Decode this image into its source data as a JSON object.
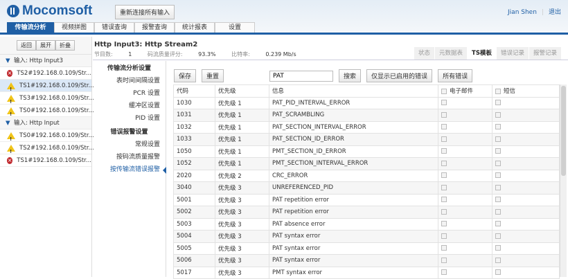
{
  "header": {
    "logo": "Mocomsoft",
    "reconnect": "重新连接所有输入",
    "user": "Jian Shen",
    "logout": "退出"
  },
  "tabs": [
    "传输流分析",
    "视频拼图",
    "错误查询",
    "报警查询",
    "统计报表",
    "设置"
  ],
  "sidebar": {
    "buttons": [
      "返回",
      "展开",
      "折叠"
    ],
    "groups": [
      {
        "label": "输入: Http Input3",
        "items": [
          {
            "label": "TS2#192.168.0.109/Str...",
            "status": "error"
          },
          {
            "label": "TS1#192.168.0.109/Str...",
            "status": "warning",
            "selected": true
          },
          {
            "label": "TS3#192.168.0.109/Str...",
            "status": "warning"
          },
          {
            "label": "TS0#192.168.0.109/Str...",
            "status": "warning"
          }
        ]
      },
      {
        "label": "输入: Http Input",
        "items": [
          {
            "label": "TS0#192.168.0.109/Str...",
            "status": "warning"
          },
          {
            "label": "TS2#192.168.0.109/Str...",
            "status": "warning"
          },
          {
            "label": "TS1#192.168.0.109/Str...",
            "status": "error"
          }
        ]
      }
    ]
  },
  "main": {
    "title": "Http Input3: Http Stream2",
    "programs_label": "节目数:",
    "programs": "1",
    "quality_label": "码流质量评分:",
    "quality": "93.3%",
    "bitrate_label": "比特率:",
    "bitrate": "0.239 Mb/s",
    "subtabs": [
      "状态",
      "元数据表",
      "TS模板",
      "错误记录",
      "报警记录"
    ],
    "active_subtab": 2
  },
  "menu": {
    "section1": "传输流分析设置",
    "items1": [
      "表时间间隔设置",
      "PCR 设置",
      "缓冲区设置",
      "PID 设置"
    ],
    "section2": "错误报警设置",
    "items2": [
      "常规设置",
      "按码流质量报警",
      "按传输流错误报警"
    ]
  },
  "toolbar": {
    "save": "保存",
    "reset": "重置",
    "search_value": "PAT",
    "search": "搜索",
    "enabled_only": "仅显示已启用的错误",
    "all": "所有错误"
  },
  "table": {
    "columns": [
      "代码",
      "优先级",
      "信息",
      "电子邮件",
      "短信"
    ],
    "rows": [
      [
        "1030",
        "优先级 1",
        "PAT_PID_INTERVAL_ERROR"
      ],
      [
        "1031",
        "优先级 1",
        "PAT_SCRAMBLING"
      ],
      [
        "1032",
        "优先级 1",
        "PAT_SECTION_INTERVAL_ERROR"
      ],
      [
        "1033",
        "优先级 1",
        "PAT_SECTION_ID_ERROR"
      ],
      [
        "1050",
        "优先级 1",
        "PMT_SECTION_ID_ERROR"
      ],
      [
        "1052",
        "优先级 1",
        "PMT_SECTION_INTERVAL_ERROR"
      ],
      [
        "2020",
        "优先级 2",
        "CRC_ERROR"
      ],
      [
        "3040",
        "优先级 3",
        "UNREFERENCED_PID"
      ],
      [
        "5001",
        "优先级 3",
        "PAT repetition error"
      ],
      [
        "5002",
        "优先级 3",
        "PAT repetition error"
      ],
      [
        "5003",
        "优先级 3",
        "PAT absence error"
      ],
      [
        "5004",
        "优先级 3",
        "PAT syntax error"
      ],
      [
        "5005",
        "优先级 3",
        "PAT syntax error"
      ],
      [
        "5006",
        "优先级 3",
        "PAT syntax error"
      ],
      [
        "5017",
        "优先级 3",
        "PMT syntax error"
      ]
    ]
  }
}
